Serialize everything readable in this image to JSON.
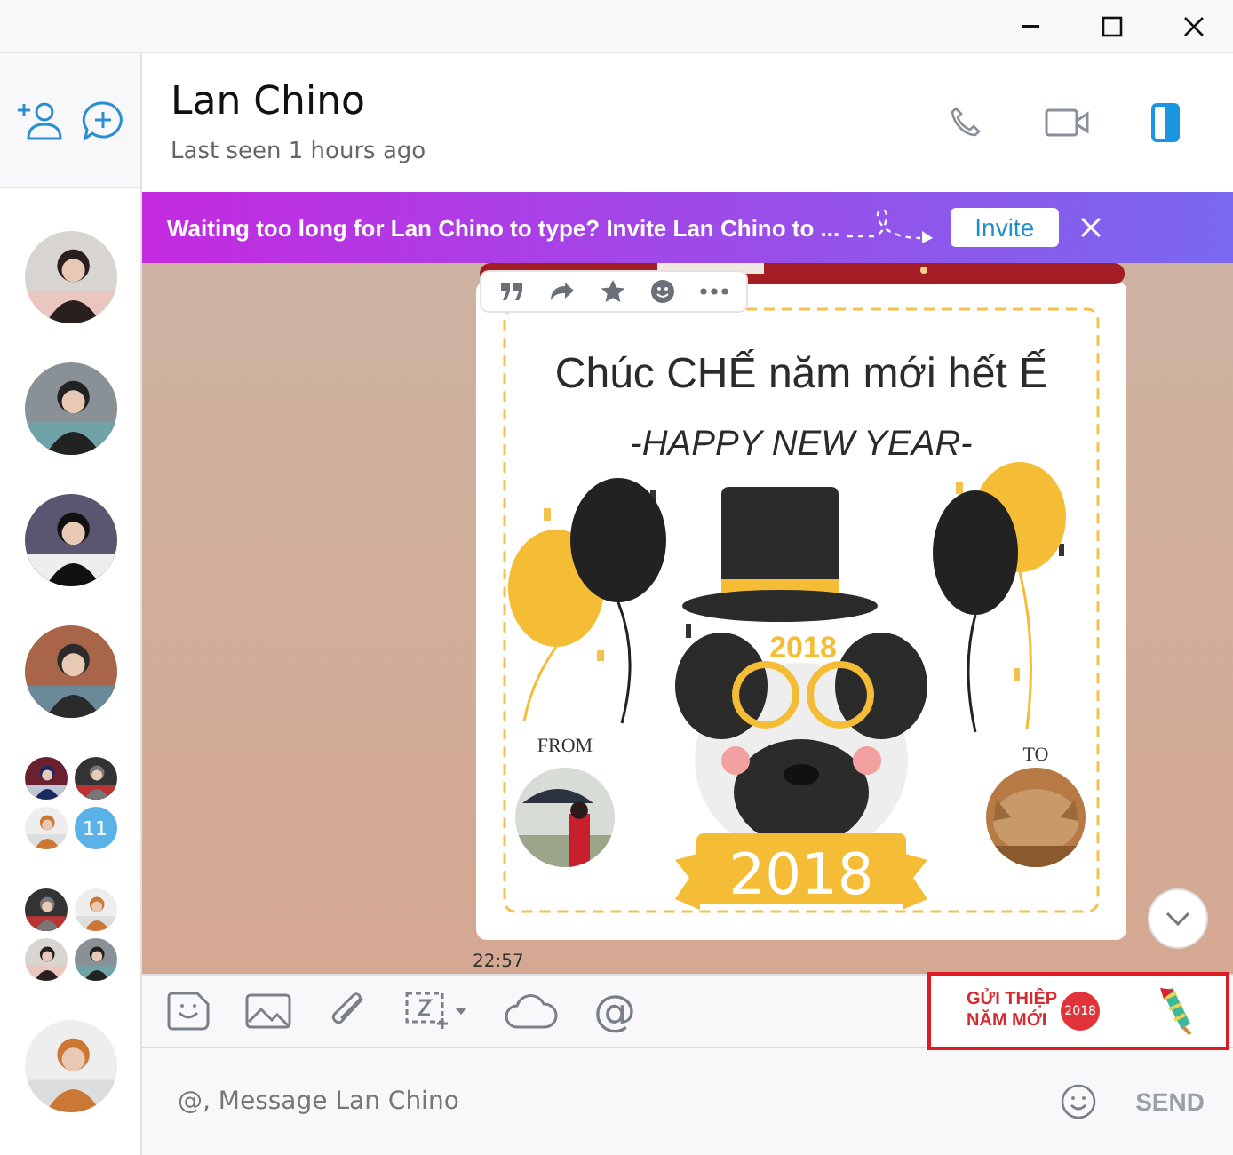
{
  "contacts": [
    {
      "kind": "single"
    },
    {
      "kind": "single"
    },
    {
      "kind": "single"
    },
    {
      "kind": "single"
    },
    {
      "kind": "group",
      "badge": "11"
    },
    {
      "kind": "group"
    },
    {
      "kind": "single"
    }
  ],
  "header": {
    "name": "Lan Chino",
    "status": "Last seen 1 hours ago"
  },
  "banner": {
    "text": "Waiting too long for Lan Chino to type? Invite Lan Chino to ...",
    "button": "Invite"
  },
  "message": {
    "card": {
      "title": "Chúc CHẾ năm mới hết Ế",
      "subtitle": "-HAPPY NEW YEAR-",
      "glasses_text": "2018",
      "from_label": "FROM",
      "to_label": "TO",
      "year": "2018"
    },
    "time": "22:57"
  },
  "toolbar": {
    "mention": "@"
  },
  "promo": {
    "line1": "GỬI THIỆP",
    "line2": "NĂM MỚI",
    "badge": "2018"
  },
  "composer": {
    "placeholder": "@, Message Lan Chino",
    "send": "SEND"
  }
}
